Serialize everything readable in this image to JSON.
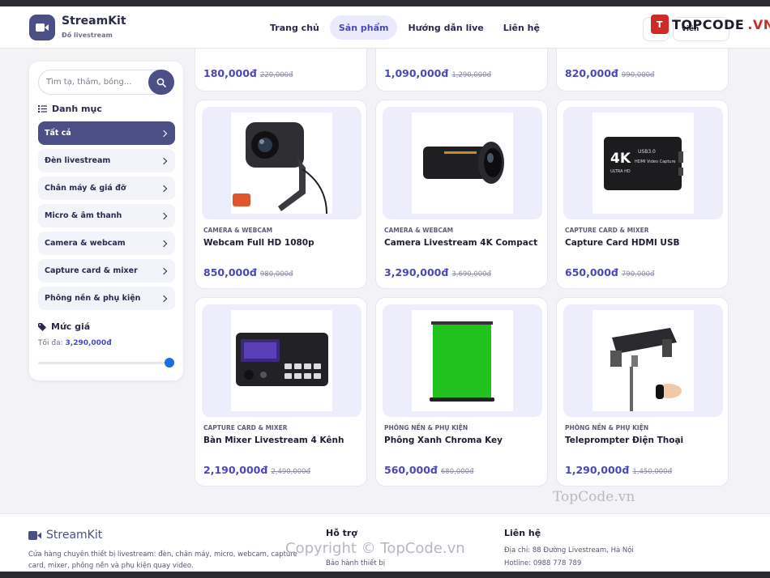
{
  "header": {
    "brand": "StreamKit",
    "tagline": "Đồ livestream",
    "nav": [
      {
        "label": "Trang chủ",
        "active": false
      },
      {
        "label": "Sản phẩm",
        "active": true
      },
      {
        "label": "Hướng dẫn live",
        "active": false
      },
      {
        "label": "Liên hệ",
        "active": false
      }
    ],
    "user_label": "viên",
    "cart_icon": "cart-icon"
  },
  "watermarks": {
    "top_brand": "TOPCODE",
    "top_tld": ".VN",
    "middle": "TopCode.vn",
    "copyright": "Copyright © TopCode.vn"
  },
  "sidebar": {
    "search_placeholder": "Tìm tạ, thảm, bóng...",
    "categories_title": "Danh mục",
    "categories": [
      {
        "label": "Tất cả",
        "active": true
      },
      {
        "label": "Đèn livestream",
        "active": false
      },
      {
        "label": "Chân máy & giá đỡ",
        "active": false
      },
      {
        "label": "Micro & âm thanh",
        "active": false
      },
      {
        "label": "Camera & webcam",
        "active": false
      },
      {
        "label": "Capture card & mixer",
        "active": false
      },
      {
        "label": "Phông nền & phụ kiện",
        "active": false
      }
    ],
    "price_title": "Mức giá",
    "price_max_label": "Tối đa:",
    "price_max_value": "3,290,000đ",
    "slider_value_fraction": 1.0
  },
  "products_partial": [
    {
      "price": "180,000đ",
      "old_price": "220,000đ"
    },
    {
      "price": "1,090,000đ",
      "old_price": "1,290,000đ"
    },
    {
      "price": "820,000đ",
      "old_price": "990,000đ"
    }
  ],
  "products": [
    {
      "category": "CAMERA & WEBCAM",
      "name": "Webcam Full HD 1080p",
      "price": "850,000đ",
      "old_price": "980,000đ",
      "image": "webcam"
    },
    {
      "category": "CAMERA & WEBCAM",
      "name": "Camera Livestream 4K Compact",
      "price": "3,290,000đ",
      "old_price": "3,690,000đ",
      "image": "camera"
    },
    {
      "category": "CAPTURE CARD & MIXER",
      "name": "Capture Card HDMI USB",
      "price": "650,000đ",
      "old_price": "790,000đ",
      "image": "capture"
    },
    {
      "category": "CAPTURE CARD & MIXER",
      "name": "Bàn Mixer Livestream 4 Kênh",
      "price": "2,190,000đ",
      "old_price": "2,490,000đ",
      "image": "mixer"
    },
    {
      "category": "PHÔNG NỀN & PHỤ KIỆN",
      "name": "Phông Xanh Chroma Key",
      "price": "560,000đ",
      "old_price": "680,000đ",
      "image": "greenscreen"
    },
    {
      "category": "PHÔNG NỀN & PHỤ KIỆN",
      "name": "Teleprompter Điện Thoại",
      "price": "1,290,000đ",
      "old_price": "1,450,000đ",
      "image": "teleprompter"
    }
  ],
  "product_image_text": {
    "capture_badge": "4K",
    "capture_usb": "USB3.0",
    "capture_model": "HDMI Video Capture",
    "capture_side": "ULTRA HD"
  },
  "footer": {
    "brand": "StreamKit",
    "description": "Cửa hàng chuyên thiết bị livestream: đèn, chân máy, micro, webcam, capture card, mixer, phông nền và phụ kiện quay video.",
    "support_title": "Hỗ trợ",
    "support_links": [
      "Bảo hành thiết bị"
    ],
    "contact_title": "Liên hệ",
    "address": "Địa chỉ: 88 Đường Livestream, Hà Nội",
    "hotline": "Hotline: 0988 778 789"
  }
}
